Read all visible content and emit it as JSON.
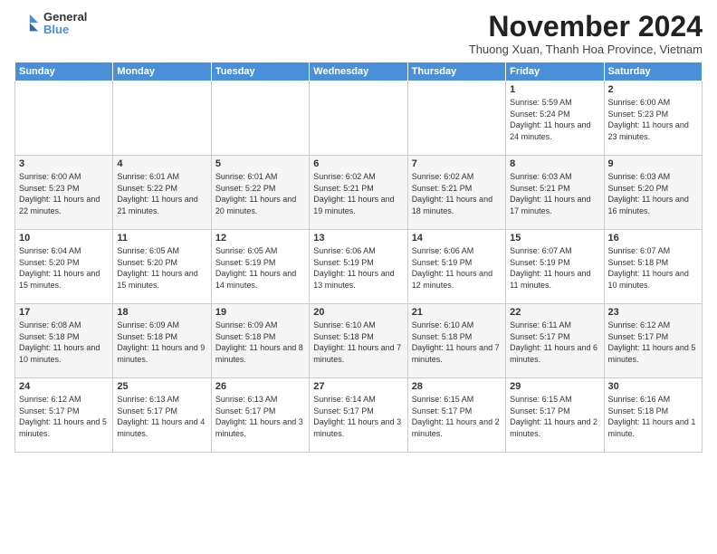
{
  "logo": {
    "line1": "General",
    "line2": "Blue"
  },
  "title": "November 2024",
  "subtitle": "Thuong Xuan, Thanh Hoa Province, Vietnam",
  "headers": [
    "Sunday",
    "Monday",
    "Tuesday",
    "Wednesday",
    "Thursday",
    "Friday",
    "Saturday"
  ],
  "weeks": [
    [
      {
        "day": "",
        "info": ""
      },
      {
        "day": "",
        "info": ""
      },
      {
        "day": "",
        "info": ""
      },
      {
        "day": "",
        "info": ""
      },
      {
        "day": "",
        "info": ""
      },
      {
        "day": "1",
        "info": "Sunrise: 5:59 AM\nSunset: 5:24 PM\nDaylight: 11 hours and 24 minutes."
      },
      {
        "day": "2",
        "info": "Sunrise: 6:00 AM\nSunset: 5:23 PM\nDaylight: 11 hours and 23 minutes."
      }
    ],
    [
      {
        "day": "3",
        "info": "Sunrise: 6:00 AM\nSunset: 5:23 PM\nDaylight: 11 hours and 22 minutes."
      },
      {
        "day": "4",
        "info": "Sunrise: 6:01 AM\nSunset: 5:22 PM\nDaylight: 11 hours and 21 minutes."
      },
      {
        "day": "5",
        "info": "Sunrise: 6:01 AM\nSunset: 5:22 PM\nDaylight: 11 hours and 20 minutes."
      },
      {
        "day": "6",
        "info": "Sunrise: 6:02 AM\nSunset: 5:21 PM\nDaylight: 11 hours and 19 minutes."
      },
      {
        "day": "7",
        "info": "Sunrise: 6:02 AM\nSunset: 5:21 PM\nDaylight: 11 hours and 18 minutes."
      },
      {
        "day": "8",
        "info": "Sunrise: 6:03 AM\nSunset: 5:21 PM\nDaylight: 11 hours and 17 minutes."
      },
      {
        "day": "9",
        "info": "Sunrise: 6:03 AM\nSunset: 5:20 PM\nDaylight: 11 hours and 16 minutes."
      }
    ],
    [
      {
        "day": "10",
        "info": "Sunrise: 6:04 AM\nSunset: 5:20 PM\nDaylight: 11 hours and 15 minutes."
      },
      {
        "day": "11",
        "info": "Sunrise: 6:05 AM\nSunset: 5:20 PM\nDaylight: 11 hours and 15 minutes."
      },
      {
        "day": "12",
        "info": "Sunrise: 6:05 AM\nSunset: 5:19 PM\nDaylight: 11 hours and 14 minutes."
      },
      {
        "day": "13",
        "info": "Sunrise: 6:06 AM\nSunset: 5:19 PM\nDaylight: 11 hours and 13 minutes."
      },
      {
        "day": "14",
        "info": "Sunrise: 6:06 AM\nSunset: 5:19 PM\nDaylight: 11 hours and 12 minutes."
      },
      {
        "day": "15",
        "info": "Sunrise: 6:07 AM\nSunset: 5:19 PM\nDaylight: 11 hours and 11 minutes."
      },
      {
        "day": "16",
        "info": "Sunrise: 6:07 AM\nSunset: 5:18 PM\nDaylight: 11 hours and 10 minutes."
      }
    ],
    [
      {
        "day": "17",
        "info": "Sunrise: 6:08 AM\nSunset: 5:18 PM\nDaylight: 11 hours and 10 minutes."
      },
      {
        "day": "18",
        "info": "Sunrise: 6:09 AM\nSunset: 5:18 PM\nDaylight: 11 hours and 9 minutes."
      },
      {
        "day": "19",
        "info": "Sunrise: 6:09 AM\nSunset: 5:18 PM\nDaylight: 11 hours and 8 minutes."
      },
      {
        "day": "20",
        "info": "Sunrise: 6:10 AM\nSunset: 5:18 PM\nDaylight: 11 hours and 7 minutes."
      },
      {
        "day": "21",
        "info": "Sunrise: 6:10 AM\nSunset: 5:18 PM\nDaylight: 11 hours and 7 minutes."
      },
      {
        "day": "22",
        "info": "Sunrise: 6:11 AM\nSunset: 5:17 PM\nDaylight: 11 hours and 6 minutes."
      },
      {
        "day": "23",
        "info": "Sunrise: 6:12 AM\nSunset: 5:17 PM\nDaylight: 11 hours and 5 minutes."
      }
    ],
    [
      {
        "day": "24",
        "info": "Sunrise: 6:12 AM\nSunset: 5:17 PM\nDaylight: 11 hours and 5 minutes."
      },
      {
        "day": "25",
        "info": "Sunrise: 6:13 AM\nSunset: 5:17 PM\nDaylight: 11 hours and 4 minutes."
      },
      {
        "day": "26",
        "info": "Sunrise: 6:13 AM\nSunset: 5:17 PM\nDaylight: 11 hours and 3 minutes."
      },
      {
        "day": "27",
        "info": "Sunrise: 6:14 AM\nSunset: 5:17 PM\nDaylight: 11 hours and 3 minutes."
      },
      {
        "day": "28",
        "info": "Sunrise: 6:15 AM\nSunset: 5:17 PM\nDaylight: 11 hours and 2 minutes."
      },
      {
        "day": "29",
        "info": "Sunrise: 6:15 AM\nSunset: 5:17 PM\nDaylight: 11 hours and 2 minutes."
      },
      {
        "day": "30",
        "info": "Sunrise: 6:16 AM\nSunset: 5:18 PM\nDaylight: 11 hours and 1 minute."
      }
    ]
  ]
}
